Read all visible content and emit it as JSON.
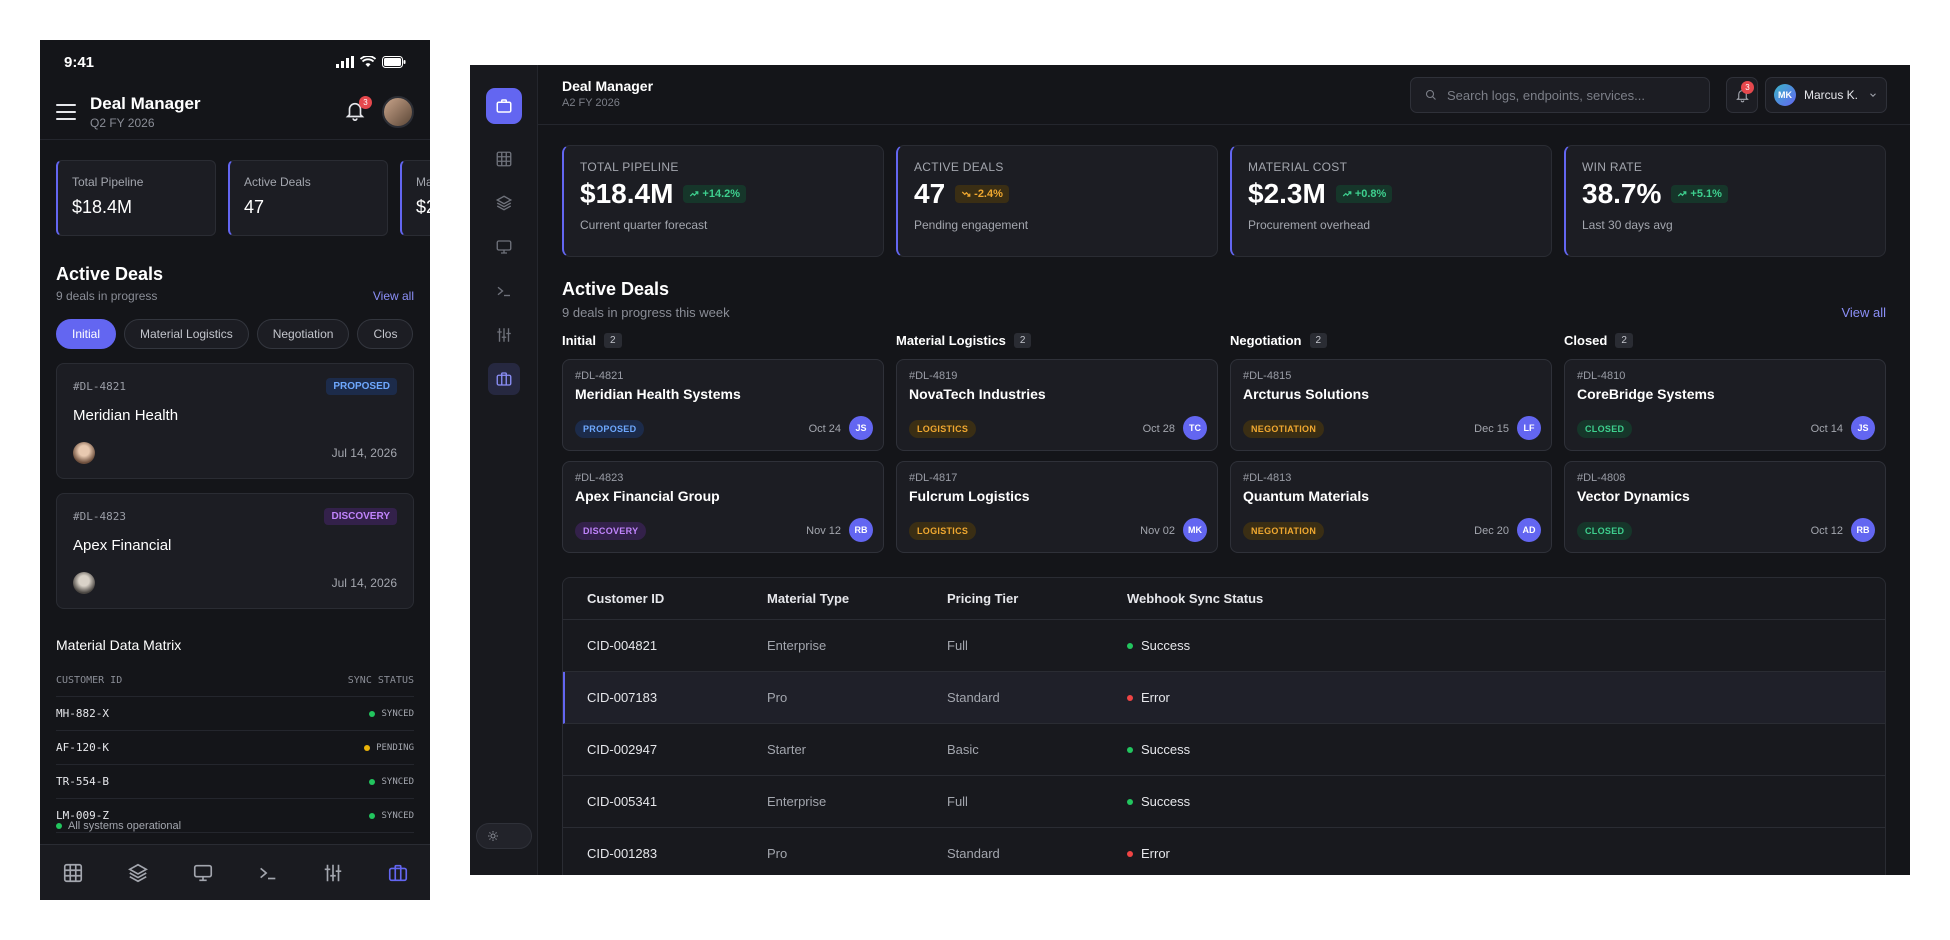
{
  "mobile": {
    "status_time": "9:41",
    "app_title": "Deal Manager",
    "app_subtitle": "Q2 FY 2026",
    "notification_count": "3",
    "kpis": [
      {
        "label": "Total Pipeline",
        "value": "$18.4M"
      },
      {
        "label": "Active Deals",
        "value": "47"
      },
      {
        "label": "Ma",
        "value": "$2"
      }
    ],
    "active_deals_title": "Active Deals",
    "active_deals_subtitle": "9 deals in progress",
    "view_all": "View all",
    "chips": [
      "Initial",
      "Material Logistics",
      "Negotiation",
      "Clos"
    ],
    "deals": [
      {
        "id": "#DL-4821",
        "name": "Meridian Health",
        "tag": "PROPOSED",
        "date": "Jul 14, 2026"
      },
      {
        "id": "#DL-4823",
        "name": "Apex Financial",
        "tag": "DISCOVERY",
        "date": "Jul 14, 2026"
      }
    ],
    "matrix_title": "Material Data Matrix",
    "matrix_headers": [
      "CUSTOMER ID",
      "SYNC STATUS"
    ],
    "matrix_rows": [
      {
        "id": "MH-882-X",
        "status": "SYNCED"
      },
      {
        "id": "AF-120-K",
        "status": "PENDING"
      },
      {
        "id": "TR-554-B",
        "status": "SYNCED"
      },
      {
        "id": "LM-009-Z",
        "status": "SYNCED"
      }
    ],
    "system_status": "All systems operational"
  },
  "desktop": {
    "app_title": "Deal Manager",
    "app_subtitle": "A2 FY 2026",
    "search_placeholder": "Search logs, endpoints, services...",
    "notification_count": "3",
    "user_initials": "MK",
    "user_name": "Marcus K.",
    "kpis": [
      {
        "label": "TOTAL PIPELINE",
        "value": "$18.4M",
        "trend": "+14.2%",
        "caption": "Current quarter forecast"
      },
      {
        "label": "ACTIVE DEALS",
        "value": "47",
        "trend": "-2.4%",
        "caption": "Pending engagement"
      },
      {
        "label": "MATERIAL COST",
        "value": "$2.3M",
        "trend": "+0.8%",
        "caption": "Procurement overhead"
      },
      {
        "label": "WIN RATE",
        "value": "38.7%",
        "trend": "+5.1%",
        "caption": "Last 30 days avg"
      }
    ],
    "active_deals_title": "Active Deals",
    "active_deals_subtitle": "9 deals in progress this week",
    "view_all": "View all",
    "columns": [
      {
        "name": "Initial",
        "count": "2",
        "cards": [
          {
            "id": "#DL-4821",
            "name": "Meridian Health Systems",
            "tag": "PROPOSED",
            "date": "Oct 24",
            "owner": "JS"
          },
          {
            "id": "#DL-4823",
            "name": "Apex Financial Group",
            "tag": "DISCOVERY",
            "date": "Nov 12",
            "owner": "RB"
          }
        ]
      },
      {
        "name": "Material Logistics",
        "count": "2",
        "cards": [
          {
            "id": "#DL-4819",
            "name": "NovaTech Industries",
            "tag": "LOGISTICS",
            "date": "Oct 28",
            "owner": "TC"
          },
          {
            "id": "#DL-4817",
            "name": "Fulcrum Logistics",
            "tag": "LOGISTICS",
            "date": "Nov 02",
            "owner": "MK"
          }
        ]
      },
      {
        "name": "Negotiation",
        "count": "2",
        "cards": [
          {
            "id": "#DL-4815",
            "name": "Arcturus Solutions",
            "tag": "NEGOTIATION",
            "date": "Dec 15",
            "owner": "LF"
          },
          {
            "id": "#DL-4813",
            "name": "Quantum Materials",
            "tag": "NEGOTIATION",
            "date": "Dec 20",
            "owner": "AD"
          }
        ]
      },
      {
        "name": "Closed",
        "count": "2",
        "cards": [
          {
            "id": "#DL-4810",
            "name": "CoreBridge Systems",
            "tag": "CLOSED",
            "date": "Oct 14",
            "owner": "JS"
          },
          {
            "id": "#DL-4808",
            "name": "Vector Dynamics",
            "tag": "CLOSED",
            "date": "Oct 12",
            "owner": "RB"
          }
        ]
      }
    ],
    "table_headers": [
      "Customer ID",
      "Material Type",
      "Pricing Tier",
      "Webhook Sync Status"
    ],
    "table_rows": [
      {
        "id": "CID-004821",
        "type": "Enterprise",
        "tier": "Full",
        "status": "Success"
      },
      {
        "id": "CID-007183",
        "type": "Pro",
        "tier": "Standard",
        "status": "Error"
      },
      {
        "id": "CID-002947",
        "type": "Starter",
        "tier": "Basic",
        "status": "Success"
      },
      {
        "id": "CID-005341",
        "type": "Enterprise",
        "tier": "Full",
        "status": "Success"
      },
      {
        "id": "CID-001283",
        "type": "Pro",
        "tier": "Standard",
        "status": "Error"
      }
    ]
  },
  "colors": {
    "accent": "#6366f1",
    "success": "#22c55e",
    "error": "#ef4444",
    "pending": "#eab308"
  }
}
